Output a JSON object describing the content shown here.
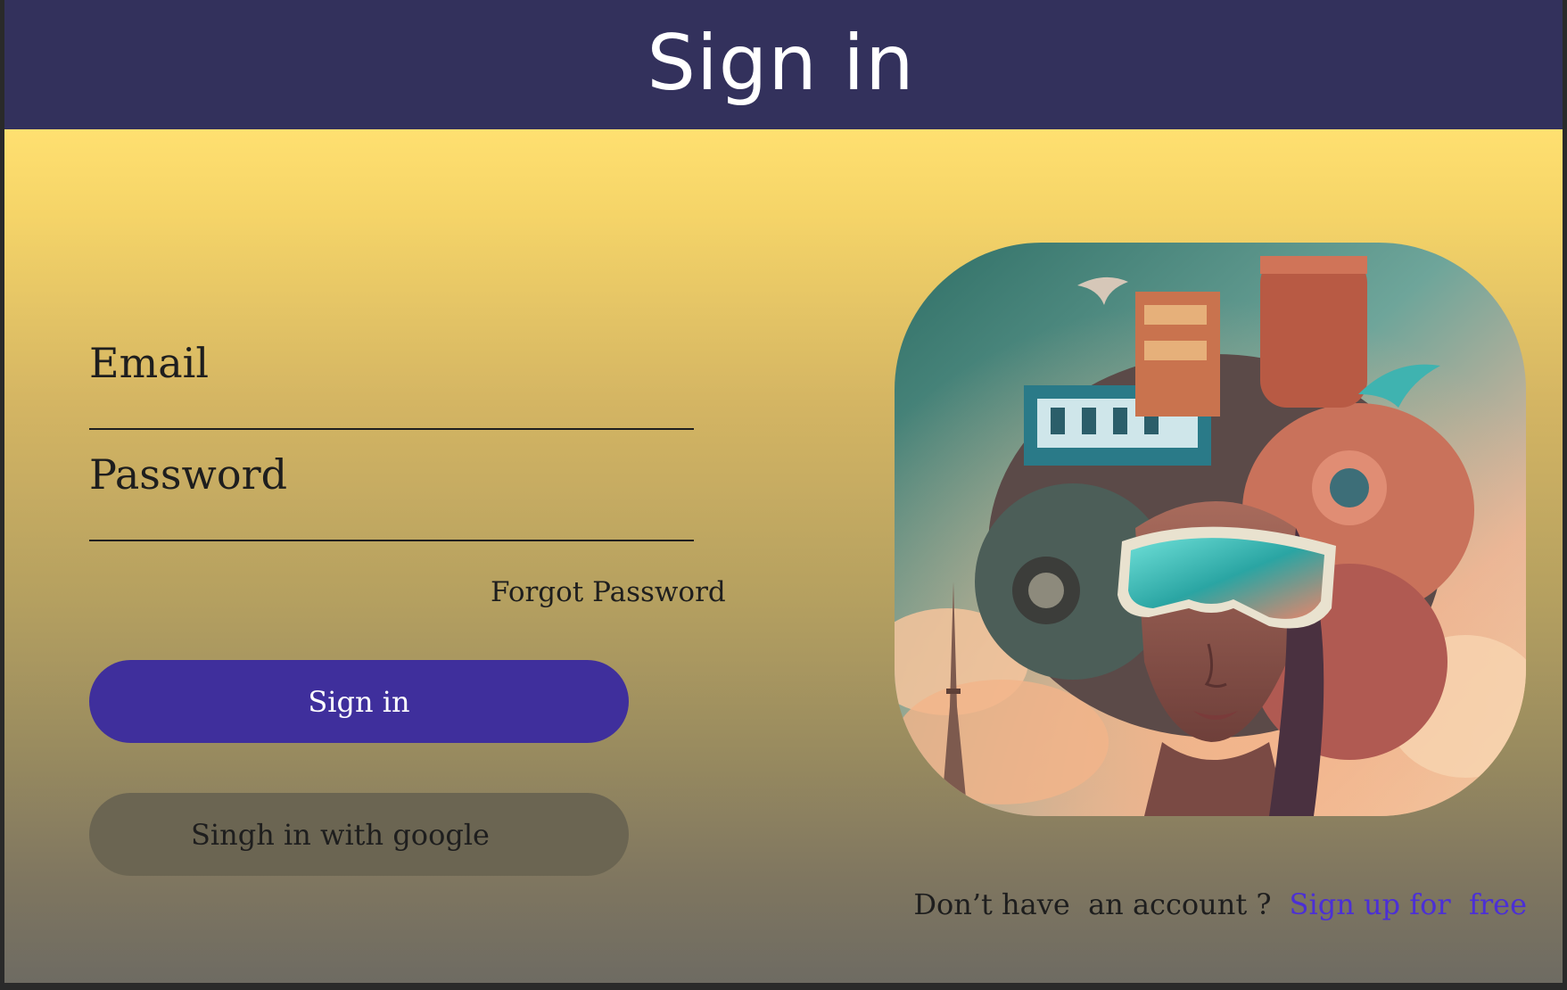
{
  "header": {
    "title": "Sign in"
  },
  "form": {
    "email_placeholder": "Email",
    "password_placeholder": "Password",
    "forgot_password": "Forgot Password",
    "signin_button": "Sign in",
    "google_button": "Singh in with google"
  },
  "footer": {
    "prompt": "Don’t have  an account ?",
    "signup_link": "Sign up for  free"
  },
  "colors": {
    "header_bg": "#33315c",
    "accent": "#3f2f9c",
    "link": "#4b2fd6",
    "gradient_top": "#ffe070",
    "gradient_bottom": "#6e6b62"
  },
  "icons": {
    "hero_image": "vr-headset-woman-illustration"
  }
}
